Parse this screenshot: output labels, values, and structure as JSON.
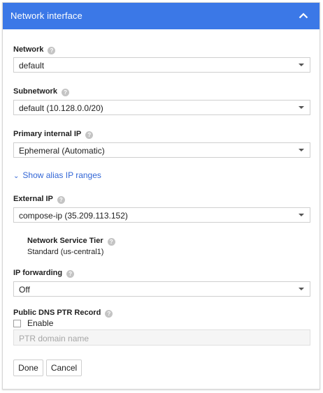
{
  "header": {
    "title": "Network interface",
    "collapse_icon": "chevron-up-icon"
  },
  "fields": {
    "network": {
      "label": "Network",
      "value": "default"
    },
    "subnetwork": {
      "label": "Subnetwork",
      "value": "default (10.128.0.0/20)"
    },
    "primary_ip": {
      "label": "Primary internal IP",
      "value": "Ephemeral (Automatic)"
    },
    "alias_link": "Show alias IP ranges",
    "external_ip": {
      "label": "External IP",
      "value": "compose-ip (35.209.113.152)"
    },
    "network_tier": {
      "label": "Network Service Tier",
      "value": "Standard (us-central1)"
    },
    "ip_forwarding": {
      "label": "IP forwarding",
      "value": "Off"
    },
    "dns_ptr": {
      "label": "Public DNS PTR Record",
      "checkbox_label": "Enable",
      "checked": false,
      "placeholder": "PTR domain name"
    }
  },
  "help_icon": "?",
  "buttons": {
    "done": "Done",
    "cancel": "Cancel"
  },
  "colors": {
    "header_bg": "#3b78e7",
    "link": "#3367d6"
  }
}
